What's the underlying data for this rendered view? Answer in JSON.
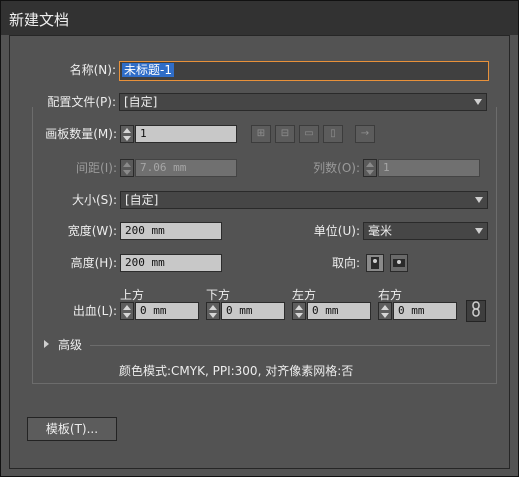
{
  "window": {
    "title": "新建文档"
  },
  "name": {
    "label": "名称(N):",
    "value": "未标题-1"
  },
  "profile": {
    "label": "配置文件(P):",
    "value": "[自定]"
  },
  "artboards": {
    "label": "画板数量(M):",
    "value": "1",
    "arrow_glyph": "→"
  },
  "spacing": {
    "label": "间距(I):",
    "value": "7.06 mm"
  },
  "columns": {
    "label": "列数(O):",
    "value": "1"
  },
  "size": {
    "label": "大小(S):",
    "value": "[自定]"
  },
  "width": {
    "label": "宽度(W):",
    "value": "200 mm"
  },
  "units": {
    "label": "单位(U):",
    "value": "毫米"
  },
  "height": {
    "label": "高度(H):",
    "value": "200 mm"
  },
  "orientation": {
    "label": "取向:"
  },
  "bleed": {
    "label": "出血(L):",
    "top": {
      "label": "上方",
      "value": "0 mm"
    },
    "bottom": {
      "label": "下方",
      "value": "0 mm"
    },
    "left": {
      "label": "左方",
      "value": "0 mm"
    },
    "right": {
      "label": "右方",
      "value": "0 mm"
    }
  },
  "advanced": {
    "label": "高级"
  },
  "info": {
    "text": "颜色模式:CMYK, PPI:300, 对齐像素网格:否"
  },
  "templates_button": {
    "label": "模板(T)..."
  },
  "colors": {
    "accent_focus": "#e8913a",
    "selection": "#2f6dc8",
    "panel": "#535353"
  },
  "icons": [
    "grid-by-row-icon",
    "grid-by-column-icon",
    "arrange-by-row-icon",
    "arrange-by-column-icon",
    "layout-direction-icon",
    "portrait-icon",
    "landscape-icon",
    "chain-link-icon",
    "expand-triangle-icon"
  ]
}
